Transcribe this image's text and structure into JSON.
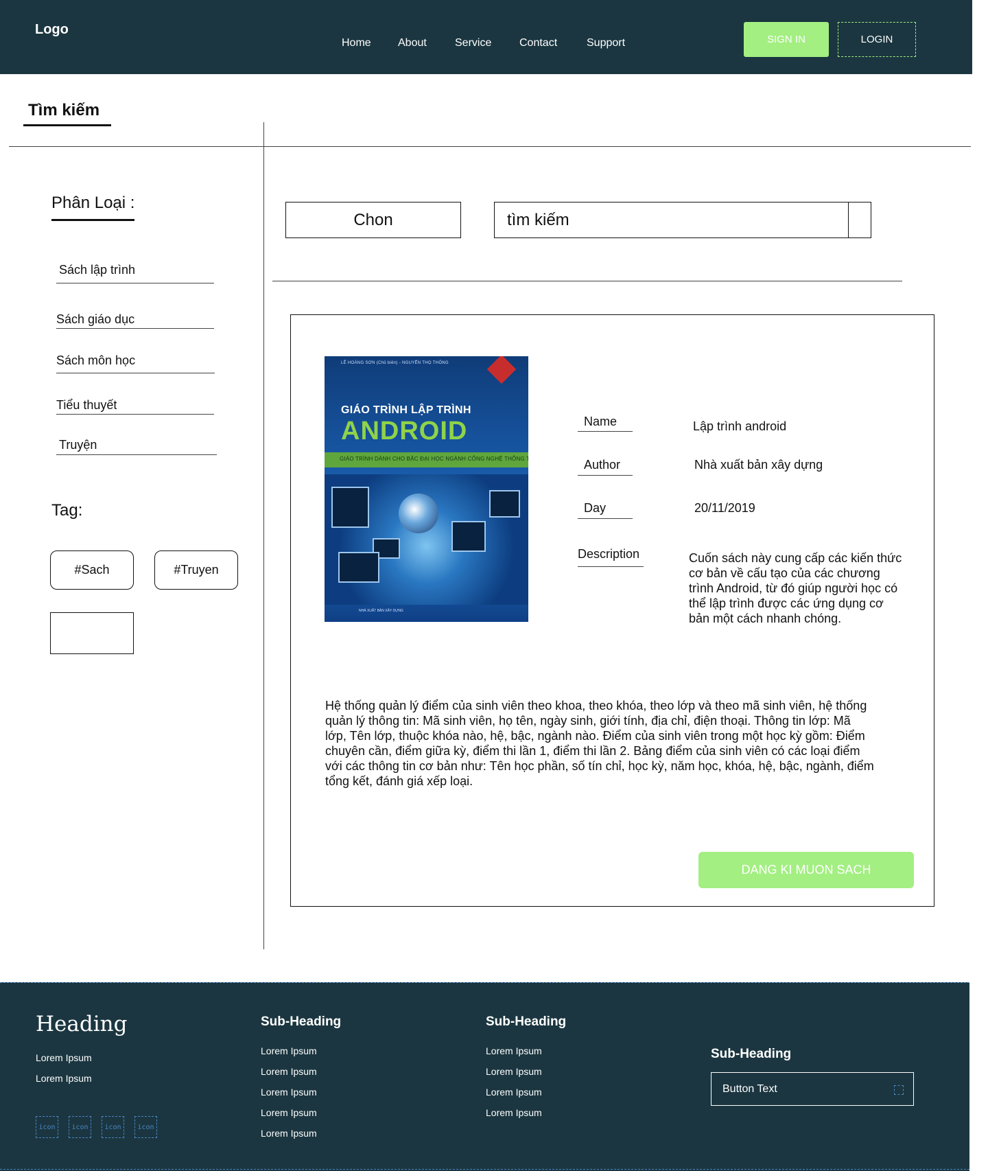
{
  "header": {
    "logo": "Logo",
    "nav": [
      "Home",
      "About",
      "Service",
      "Contact",
      "Support"
    ],
    "sign_in": "SIGN IN",
    "login": "LOGIN"
  },
  "page": {
    "title": "Tìm kiếm"
  },
  "sidebar": {
    "category_heading": "Phân Loại :",
    "categories": [
      "Sách lập trình",
      "Sách giáo dục",
      "Sách môn học",
      "Tiểu thuyết",
      "Truyện"
    ],
    "tag_heading": "Tag:",
    "tags": [
      "#Sach",
      "#Truyen"
    ]
  },
  "search": {
    "choose_label": "Chon",
    "input_value": "tìm kiếm"
  },
  "book": {
    "cover": {
      "authors": "LÊ HOÀNG SƠN (Chủ biên) - NGUYỄN THỌ THÔNG",
      "title_line1": "GIÁO TRÌNH LẬP TRÌNH",
      "title_line2": "ANDROID",
      "subtitle": "GIÁO TRÌNH DÀNH CHO BẬC ĐẠI HỌC NGÀNH CÔNG NGHỆ THÔNG TIN",
      "publisher": "NHÀ XUẤT BẢN XÂY DỰNG"
    },
    "fields": {
      "name_label": "Name",
      "name_value": "Lập trình android",
      "author_label": "Author",
      "author_value": "Nhà xuất bản xây dựng",
      "day_label": "Day",
      "day_value": "20/11/2019",
      "description_label": "Description",
      "description_value": "Cuốn sách này cung cấp các kiến thức cơ bản về cấu tạo của các chương trình Android, từ đó giúp người học có thể lập trình được các ứng dụng cơ bản một cách nhanh chóng."
    },
    "long_text": "Hệ thống quản lý điểm của sinh viên theo khoa, theo khóa, theo lớp và theo mã sinh viên, hệ thống quản lý thông tin: Mã sinh viên, họ tên, ngày sinh, giới tính, địa chỉ, điện thoại. Thông tin lớp: Mã lớp, Tên lớp, thuộc khóa nào, hệ, bậc, ngành nào. Điểm của sinh viên trong một học kỳ gồm: Điểm chuyên cần, điểm giữa kỳ, điểm thi lần 1, điểm thi lần 2. Bảng điểm của sinh viên có các loại điểm với các thông tin cơ bản như: Tên học phần, số tín chỉ, học kỳ, năm học, khóa, hệ, bậc, ngành, điểm tổng kết, đánh giá xếp loại.",
    "borrow_button": "DANG KI MUON SACH"
  },
  "footer": {
    "heading": "Heading",
    "col1_links": [
      "Lorem Ipsum",
      "Lorem Ipsum"
    ],
    "icons": [
      "icon",
      "icon",
      "icon",
      "icon"
    ],
    "col2_heading": "Sub-Heading",
    "col2_links": [
      "Lorem Ipsum",
      "Lorem Ipsum",
      "Lorem Ipsum",
      "Lorem Ipsum",
      "Lorem Ipsum"
    ],
    "col3_heading": "Sub-Heading",
    "col3_links": [
      "Lorem Ipsum",
      "Lorem Ipsum",
      "Lorem Ipsum",
      "Lorem Ipsum"
    ],
    "col4_heading": "Sub-Heading",
    "col4_button": "Button Text"
  },
  "colors": {
    "header_bg": "#1b3640",
    "accent_green": "#a3ef82",
    "dashed_blue": "#4a86c8"
  }
}
